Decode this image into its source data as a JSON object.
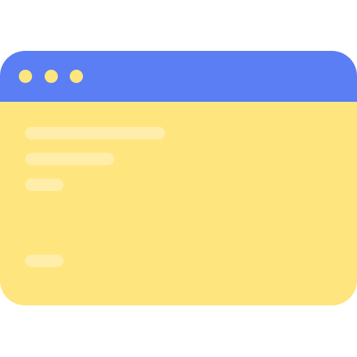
{
  "window": {
    "titlebar_color": "#5B7EF5",
    "body_color": "#FFE57D",
    "dot_color": "#FFE57D",
    "placeholder_color": "#FFEDAA",
    "controls": [
      {
        "icon": "window-dot-icon"
      },
      {
        "icon": "window-dot-icon"
      },
      {
        "icon": "window-dot-icon"
      }
    ],
    "content_lines": [
      {
        "name": "placeholder-line"
      },
      {
        "name": "placeholder-line"
      },
      {
        "name": "placeholder-line"
      },
      {
        "name": "placeholder-line"
      }
    ]
  }
}
